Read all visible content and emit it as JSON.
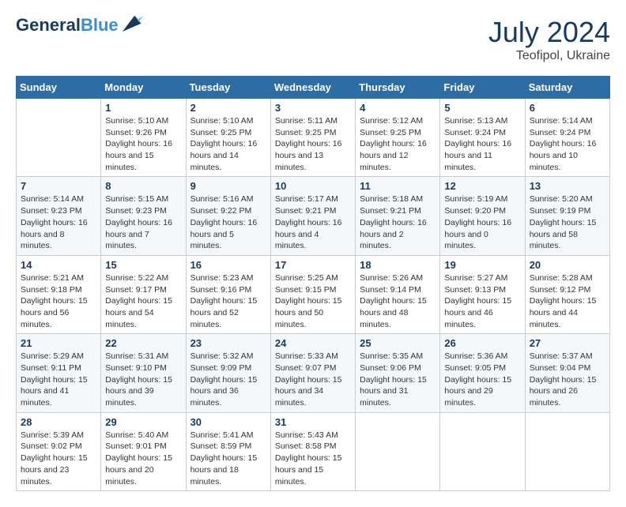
{
  "header": {
    "logo_line1": "General",
    "logo_line2": "Blue",
    "title": "July 2024",
    "subtitle": "Teofipol, Ukraine"
  },
  "weekdays": [
    "Sunday",
    "Monday",
    "Tuesday",
    "Wednesday",
    "Thursday",
    "Friday",
    "Saturday"
  ],
  "weeks": [
    [
      {
        "day": "",
        "sunrise": "",
        "sunset": "",
        "daylight": ""
      },
      {
        "day": "1",
        "sunrise": "5:10 AM",
        "sunset": "9:26 PM",
        "daylight": "16 hours and 15 minutes."
      },
      {
        "day": "2",
        "sunrise": "5:10 AM",
        "sunset": "9:25 PM",
        "daylight": "16 hours and 14 minutes."
      },
      {
        "day": "3",
        "sunrise": "5:11 AM",
        "sunset": "9:25 PM",
        "daylight": "16 hours and 13 minutes."
      },
      {
        "day": "4",
        "sunrise": "5:12 AM",
        "sunset": "9:25 PM",
        "daylight": "16 hours and 12 minutes."
      },
      {
        "day": "5",
        "sunrise": "5:13 AM",
        "sunset": "9:24 PM",
        "daylight": "16 hours and 11 minutes."
      },
      {
        "day": "6",
        "sunrise": "5:14 AM",
        "sunset": "9:24 PM",
        "daylight": "16 hours and 10 minutes."
      }
    ],
    [
      {
        "day": "7",
        "sunrise": "5:14 AM",
        "sunset": "9:23 PM",
        "daylight": "16 hours and 8 minutes."
      },
      {
        "day": "8",
        "sunrise": "5:15 AM",
        "sunset": "9:23 PM",
        "daylight": "16 hours and 7 minutes."
      },
      {
        "day": "9",
        "sunrise": "5:16 AM",
        "sunset": "9:22 PM",
        "daylight": "16 hours and 5 minutes."
      },
      {
        "day": "10",
        "sunrise": "5:17 AM",
        "sunset": "9:21 PM",
        "daylight": "16 hours and 4 minutes."
      },
      {
        "day": "11",
        "sunrise": "5:18 AM",
        "sunset": "9:21 PM",
        "daylight": "16 hours and 2 minutes."
      },
      {
        "day": "12",
        "sunrise": "5:19 AM",
        "sunset": "9:20 PM",
        "daylight": "16 hours and 0 minutes."
      },
      {
        "day": "13",
        "sunrise": "5:20 AM",
        "sunset": "9:19 PM",
        "daylight": "15 hours and 58 minutes."
      }
    ],
    [
      {
        "day": "14",
        "sunrise": "5:21 AM",
        "sunset": "9:18 PM",
        "daylight": "15 hours and 56 minutes."
      },
      {
        "day": "15",
        "sunrise": "5:22 AM",
        "sunset": "9:17 PM",
        "daylight": "15 hours and 54 minutes."
      },
      {
        "day": "16",
        "sunrise": "5:23 AM",
        "sunset": "9:16 PM",
        "daylight": "15 hours and 52 minutes."
      },
      {
        "day": "17",
        "sunrise": "5:25 AM",
        "sunset": "9:15 PM",
        "daylight": "15 hours and 50 minutes."
      },
      {
        "day": "18",
        "sunrise": "5:26 AM",
        "sunset": "9:14 PM",
        "daylight": "15 hours and 48 minutes."
      },
      {
        "day": "19",
        "sunrise": "5:27 AM",
        "sunset": "9:13 PM",
        "daylight": "15 hours and 46 minutes."
      },
      {
        "day": "20",
        "sunrise": "5:28 AM",
        "sunset": "9:12 PM",
        "daylight": "15 hours and 44 minutes."
      }
    ],
    [
      {
        "day": "21",
        "sunrise": "5:29 AM",
        "sunset": "9:11 PM",
        "daylight": "15 hours and 41 minutes."
      },
      {
        "day": "22",
        "sunrise": "5:31 AM",
        "sunset": "9:10 PM",
        "daylight": "15 hours and 39 minutes."
      },
      {
        "day": "23",
        "sunrise": "5:32 AM",
        "sunset": "9:09 PM",
        "daylight": "15 hours and 36 minutes."
      },
      {
        "day": "24",
        "sunrise": "5:33 AM",
        "sunset": "9:07 PM",
        "daylight": "15 hours and 34 minutes."
      },
      {
        "day": "25",
        "sunrise": "5:35 AM",
        "sunset": "9:06 PM",
        "daylight": "15 hours and 31 minutes."
      },
      {
        "day": "26",
        "sunrise": "5:36 AM",
        "sunset": "9:05 PM",
        "daylight": "15 hours and 29 minutes."
      },
      {
        "day": "27",
        "sunrise": "5:37 AM",
        "sunset": "9:04 PM",
        "daylight": "15 hours and 26 minutes."
      }
    ],
    [
      {
        "day": "28",
        "sunrise": "5:39 AM",
        "sunset": "9:02 PM",
        "daylight": "15 hours and 23 minutes."
      },
      {
        "day": "29",
        "sunrise": "5:40 AM",
        "sunset": "9:01 PM",
        "daylight": "15 hours and 20 minutes."
      },
      {
        "day": "30",
        "sunrise": "5:41 AM",
        "sunset": "8:59 PM",
        "daylight": "15 hours and 18 minutes."
      },
      {
        "day": "31",
        "sunrise": "5:43 AM",
        "sunset": "8:58 PM",
        "daylight": "15 hours and 15 minutes."
      },
      {
        "day": "",
        "sunrise": "",
        "sunset": "",
        "daylight": ""
      },
      {
        "day": "",
        "sunrise": "",
        "sunset": "",
        "daylight": ""
      },
      {
        "day": "",
        "sunrise": "",
        "sunset": "",
        "daylight": ""
      }
    ]
  ],
  "daylight_label": "Daylight hours",
  "sunrise_label": "Sunrise:",
  "sunset_label": "Sunset:"
}
